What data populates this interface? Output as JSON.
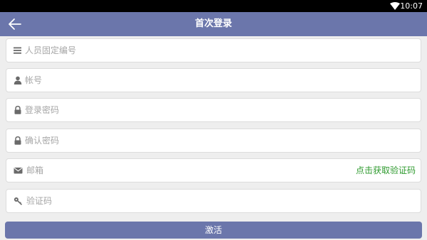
{
  "status_bar": {
    "time": "10:07",
    "wifi_icon": "wifi-icon"
  },
  "app_bar": {
    "back_icon": "arrow-left-icon",
    "title": "首次登录",
    "color": "#6b76ab"
  },
  "form": {
    "fields": [
      {
        "icon": "list-icon",
        "placeholder": "人员固定编号",
        "value": ""
      },
      {
        "icon": "user-icon",
        "placeholder": "帐号",
        "value": ""
      },
      {
        "icon": "lock-icon",
        "placeholder": "登录密码",
        "value": ""
      },
      {
        "icon": "lock-icon",
        "placeholder": "确认密码",
        "value": ""
      },
      {
        "icon": "envelope-icon",
        "placeholder": "邮箱",
        "value": "",
        "action": "点击获取验证码"
      },
      {
        "icon": "key-icon",
        "placeholder": "验证码",
        "value": ""
      }
    ],
    "action_color": "#2e9a2e"
  },
  "submit": {
    "label": "激活"
  }
}
